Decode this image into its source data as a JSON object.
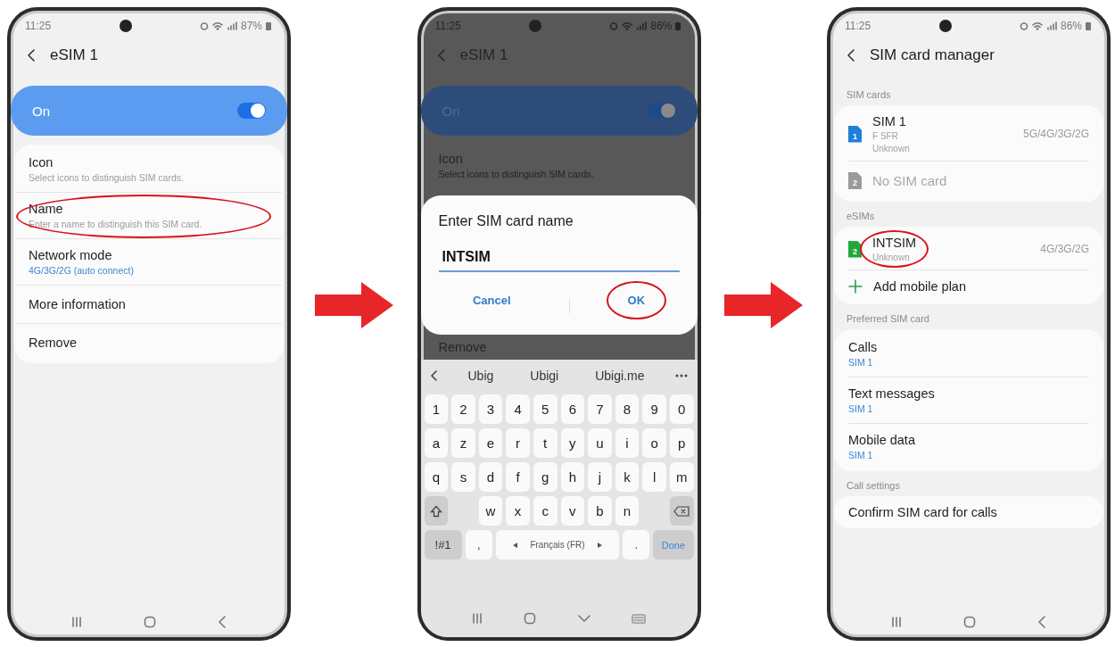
{
  "phones": [
    {
      "kind": "settings",
      "status": {
        "time": "11:25",
        "battery": "87%"
      },
      "title": "eSIM 1",
      "toggle": {
        "label": "On",
        "on": true
      },
      "items": [
        {
          "title": "Icon",
          "subtitle": "Select icons to distinguish SIM cards.",
          "accent": false,
          "circled": false
        },
        {
          "title": "Name",
          "subtitle": "Enter a name to distinguish this SIM card.",
          "accent": false,
          "circled": true
        },
        {
          "title": "Network mode",
          "subtitle": "4G/3G/2G (auto connect)",
          "accent": true,
          "circled": false
        },
        {
          "title": "More information",
          "circled": false
        },
        {
          "title": "Remove",
          "circled": false
        }
      ]
    },
    {
      "kind": "dialog",
      "status": {
        "time": "11:25",
        "battery": "86%"
      },
      "title": "eSIM 1",
      "toggle": {
        "label": "On",
        "on": true
      },
      "items_above": [
        {
          "title": "Icon",
          "subtitle": "Select icons to distinguish SIM cards."
        }
      ],
      "dialog": {
        "title": "Enter SIM card name",
        "value": "INTSIM",
        "buttons": [
          {
            "label": "Cancel",
            "circled": false
          },
          {
            "label": "OK",
            "circled": true
          }
        ]
      },
      "items_below": [
        {
          "title": "Remove"
        }
      ],
      "keyboard": {
        "suggestions": [
          "Ubig",
          "Ubigi",
          "Ubigi.me"
        ],
        "rows": [
          [
            "1",
            "2",
            "3",
            "4",
            "5",
            "6",
            "7",
            "8",
            "9",
            "0"
          ],
          [
            "a",
            "z",
            "e",
            "r",
            "t",
            "y",
            "u",
            "i",
            "o",
            "p"
          ],
          [
            "q",
            "s",
            "d",
            "f",
            "g",
            "h",
            "j",
            "k",
            "l",
            "m"
          ],
          [
            "",
            "",
            "w",
            "x",
            "c",
            "v",
            "b",
            "n",
            "",
            ""
          ]
        ],
        "symbols_key": "!#1",
        "comma": ",",
        "space_label": "Français (FR)",
        "period": ".",
        "done": "Done"
      }
    },
    {
      "kind": "manager",
      "status": {
        "time": "11:25",
        "battery": "86%"
      },
      "title": "SIM card manager",
      "sections": [
        {
          "label": "SIM cards",
          "rows": [
            {
              "kind": "sim",
              "badge": "1",
              "color": "#1e7fd8",
              "title": "SIM 1",
              "lines": [
                "F SFR",
                "Unknown"
              ],
              "tech": "5G/4G/3G/2G",
              "disabled": false,
              "circled": false
            },
            {
              "kind": "sim",
              "badge": "2",
              "color": "#9a9a9a",
              "title": "No SIM card",
              "disabled": true,
              "circled": false
            }
          ]
        },
        {
          "label": "eSIMs",
          "rows": [
            {
              "kind": "sim",
              "badge": "2",
              "color": "#22a83a",
              "title": "INTSIM",
              "lines": [
                "Unknown"
              ],
              "tech": "4G/3G/2G",
              "disabled": false,
              "circled": true
            },
            {
              "kind": "add",
              "title": "Add mobile plan"
            }
          ]
        },
        {
          "label": "Preferred SIM card",
          "rows": [
            {
              "kind": "setting",
              "title": "Calls",
              "subtitle": "SIM 1",
              "accent": true
            },
            {
              "kind": "setting",
              "title": "Text messages",
              "subtitle": "SIM 1",
              "accent": true
            },
            {
              "kind": "setting",
              "title": "Mobile data",
              "subtitle": "SIM 1",
              "accent": true
            }
          ]
        },
        {
          "label": "Call settings",
          "rows": [
            {
              "kind": "setting",
              "title": "Confirm SIM card for calls"
            }
          ]
        }
      ]
    }
  ]
}
